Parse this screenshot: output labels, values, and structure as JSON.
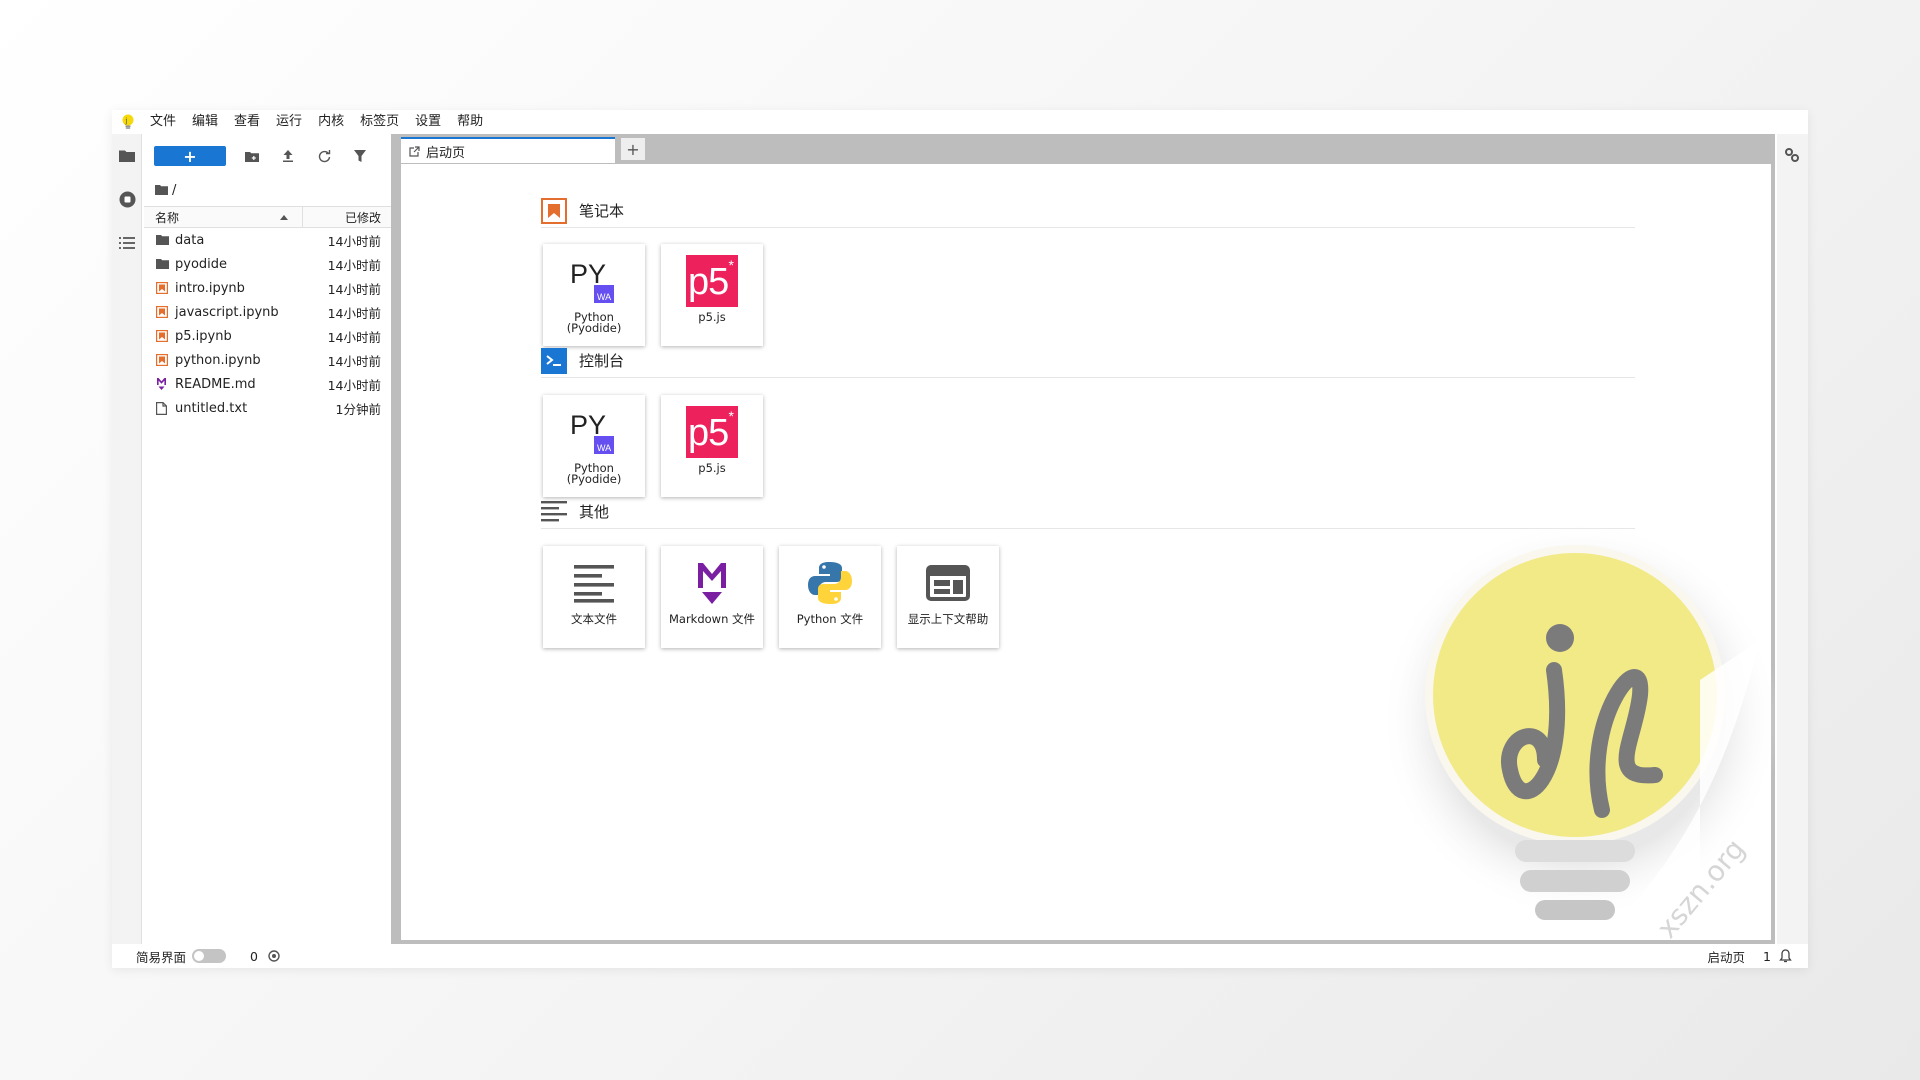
{
  "menu": [
    "文件",
    "编辑",
    "查看",
    "运行",
    "内核",
    "标签页",
    "设置",
    "帮助"
  ],
  "filebrowser": {
    "new_label": "+",
    "breadcrumb": "/",
    "header": {
      "name": "名称",
      "modified": "已修改"
    },
    "files": [
      {
        "name": "data",
        "modified": "14小时前",
        "icon": "folder-icon"
      },
      {
        "name": "pyodide",
        "modified": "14小时前",
        "icon": "folder-icon"
      },
      {
        "name": "intro.ipynb",
        "modified": "14小时前",
        "icon": "notebook-icon"
      },
      {
        "name": "javascript.ipynb",
        "modified": "14小时前",
        "icon": "notebook-icon"
      },
      {
        "name": "p5.ipynb",
        "modified": "14小时前",
        "icon": "notebook-icon"
      },
      {
        "name": "python.ipynb",
        "modified": "14小时前",
        "icon": "notebook-icon"
      },
      {
        "name": "README.md",
        "modified": "14小时前",
        "icon": "markdown-icon"
      },
      {
        "name": "untitled.txt",
        "modified": "1分钟前",
        "icon": "file-icon"
      }
    ]
  },
  "tab": {
    "label": "启动页",
    "add": "+"
  },
  "launcher": {
    "notebook": {
      "title": "笔记本",
      "cards": [
        {
          "label_line1": "Python",
          "label_line2": "(Pyodide)"
        },
        {
          "label": "p5.js"
        }
      ]
    },
    "console": {
      "title": "控制台",
      "cards": [
        {
          "label_line1": "Python",
          "label_line2": "(Pyodide)"
        },
        {
          "label": "p5.js"
        }
      ]
    },
    "other": {
      "title": "其他",
      "cards": [
        {
          "label": "文本文件"
        },
        {
          "label": "Markdown 文件"
        },
        {
          "label": "Python 文件"
        },
        {
          "label": "显示上下文帮助"
        }
      ]
    },
    "py_logo_text": "PY",
    "wa_text": "WA",
    "p5_text": "p5",
    "p5_star": "*"
  },
  "statusbar": {
    "simple_mode": "简易界面",
    "kernel_count": "0",
    "right_label": "启动页",
    "right_count": "1"
  },
  "watermark": {
    "text": "xszn.org"
  },
  "colors": {
    "accent": "#1976d2",
    "notebook": "#e46e2e",
    "markdown": "#7b1fa2",
    "p5": "#ed225d"
  }
}
